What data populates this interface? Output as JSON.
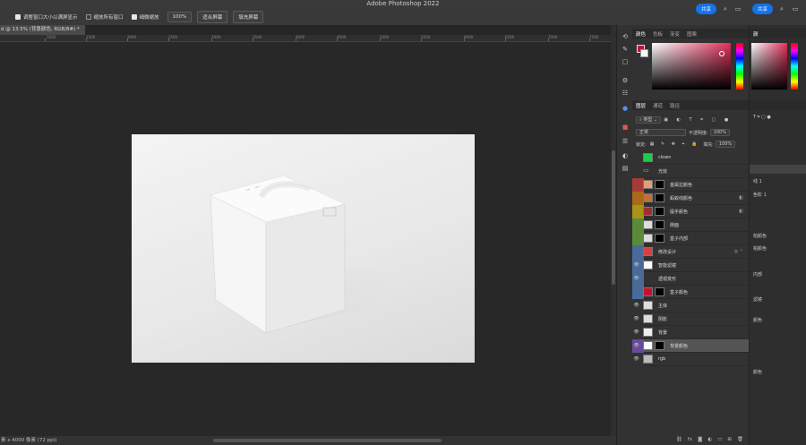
{
  "app": {
    "title": "Adobe Photoshop 2022"
  },
  "options": {
    "resize_windows": "调整窗口大小以满屏显示",
    "zoom_all": "缩放所有窗口",
    "scrubby_zoom": "细微缩放",
    "zoom_value": "100%",
    "fit_screen": "适合屏幕",
    "fill_screen": "填充屏幕",
    "share": "共享"
  },
  "document": {
    "tab_title": "d @ 13.5% (背景颜色, RGB/8#) *",
    "status": "素 x 4000 像素 (72 ppi)"
  },
  "ruler": {
    "labels": [
      "1000",
      "1500",
      "2000",
      "2500",
      "3000",
      "3500",
      "4000",
      "4500",
      "5000",
      "5500",
      "6000",
      "6500",
      "7000",
      "7500"
    ]
  },
  "color_panel": {
    "tabs": [
      "颜色",
      "色板",
      "渐变",
      "图案"
    ],
    "foreground": "#c8102e",
    "background": "#ffffff"
  },
  "layers_panel": {
    "tabs": [
      "图层",
      "通道",
      "路径"
    ],
    "filter_kind": "类型",
    "blend_mode": "正常",
    "opacity_label": "不透明度:",
    "opacity_value": "100%",
    "lock_label": "锁定:",
    "fill_label": "填充:",
    "fill_value": "100%",
    "layers": [
      {
        "name": "clown",
        "color": "#323232",
        "thumb": "#22cc44",
        "mask": false,
        "eye": "",
        "fx": ""
      },
      {
        "name": "光效",
        "color": "#323232",
        "thumb": "folder",
        "mask": false,
        "eye": "",
        "fx": ""
      },
      {
        "name": "金属拉颜色",
        "color": "#a83a3a",
        "thumb": "#e0a070",
        "mask": true,
        "eye": "",
        "fx": ""
      },
      {
        "name": "蚂蚁线颜色",
        "color": "#a86a1a",
        "thumb": "#c07040",
        "mask": true,
        "eye": "",
        "fx": "◧"
      },
      {
        "name": "提手颜色",
        "color": "#a8921a",
        "thumb": "#a03030",
        "mask": true,
        "eye": "",
        "fx": "◧"
      },
      {
        "name": "侧面",
        "color": "#5a8a3a",
        "thumb": "#dddddd",
        "mask": true,
        "eye": "",
        "fx": ""
      },
      {
        "name": "盒子内部",
        "color": "#5a8a3a",
        "thumb": "#dddddd",
        "mask": true,
        "eye": "",
        "fx": ""
      },
      {
        "name": "修改设计",
        "color": "#4a6a9a",
        "thumb": "#d84040",
        "mask": false,
        "eye": "",
        "fx": "◎ ⌃"
      },
      {
        "name": "智能滤镜",
        "color": "#4a6a9a",
        "thumb": "#ffffff",
        "mask": false,
        "eye": "👁",
        "fx": ""
      },
      {
        "name": "透视变形",
        "color": "#4a6a9a",
        "thumb": "",
        "mask": false,
        "eye": "👁",
        "fx": ""
      },
      {
        "name": "盒子颜色",
        "color": "#4a6a9a",
        "thumb": "#c8102e",
        "mask": true,
        "eye": "",
        "fx": ""
      },
      {
        "name": "主体",
        "color": "#323232",
        "thumb": "#dddddd",
        "mask": false,
        "eye": "👁",
        "fx": ""
      },
      {
        "name": "阴影",
        "color": "#323232",
        "thumb": "#dddddd",
        "mask": false,
        "eye": "👁",
        "fx": ""
      },
      {
        "name": "背景",
        "color": "#323232",
        "thumb": "#eeeeee",
        "mask": false,
        "eye": "👁",
        "fx": ""
      },
      {
        "name": "背景颜色",
        "color": "#6a4a9a",
        "thumb": "#ffffff",
        "mask": true,
        "eye": "👁",
        "fx": "",
        "selected": true
      },
      {
        "name": "rgb",
        "color": "#323232",
        "thumb": "#bbbbbb",
        "mask": false,
        "eye": "👁",
        "fx": ""
      }
    ]
  },
  "panel2": {
    "tabs": [
      "颜"
    ],
    "items": [
      "线 1",
      "色阶 1",
      "柏颜色",
      "柏颜色",
      "内部",
      "滤镜",
      "颜色",
      "颜色"
    ]
  },
  "accent": "#1473e6"
}
